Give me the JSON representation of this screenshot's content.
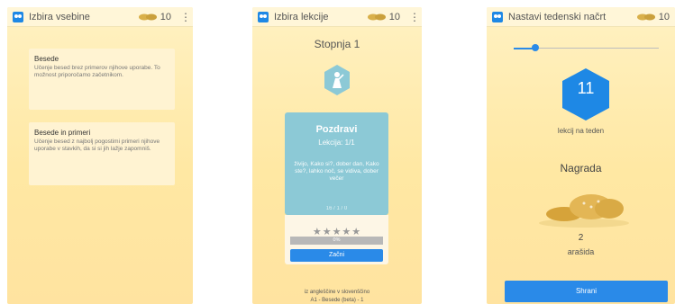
{
  "colors": {
    "accent": "#2a8ae8",
    "card_teal": "#8cc9d6",
    "background": "#ffeab0",
    "hex_blue": "#1e88e5"
  },
  "screen1": {
    "appbar": {
      "title": "Izbira vsebine",
      "peanut_count": "10",
      "menu_icon": "more-vert-icon"
    },
    "cards": [
      {
        "title": "Besede",
        "text": "Učenje besed brez primerov njihove uporabe. To možnost priporočamo začetnikom."
      },
      {
        "title": "Besede in primeri",
        "text": "Učenje besed z najbolj pogostimi primeri njihove uporabe v stavkih, da si si jih lažje zapomniš."
      }
    ]
  },
  "screen2": {
    "appbar": {
      "title": "Izbira lekcije",
      "peanut_count": "10"
    },
    "level_title": "Stopnja 1",
    "lesson": {
      "title": "Pozdravi",
      "subtitle": "Lekcija: 1/1",
      "words": "živijo, Kako si?, dober dan, Kako ste?, lahko noč, se vidiva, dober večer",
      "meta": "16 / 1 / 0",
      "stars": "★★★★★",
      "progress_label": "0%",
      "progress": 0,
      "start_label": "Začni"
    },
    "footer_line1": "iz angleščine v slovenščino",
    "footer_line2": "A1 - Besede (beta) - 1"
  },
  "screen3": {
    "appbar": {
      "title": "Nastavi tedenski načrt",
      "peanut_count": "10"
    },
    "slider_value": 0.15,
    "lessons_per_week": "11",
    "lessons_label": "lekcij na teden",
    "reward_title": "Nagrada",
    "reward_amount": "2",
    "reward_unit": "arašida",
    "save_label": "Shrani"
  }
}
